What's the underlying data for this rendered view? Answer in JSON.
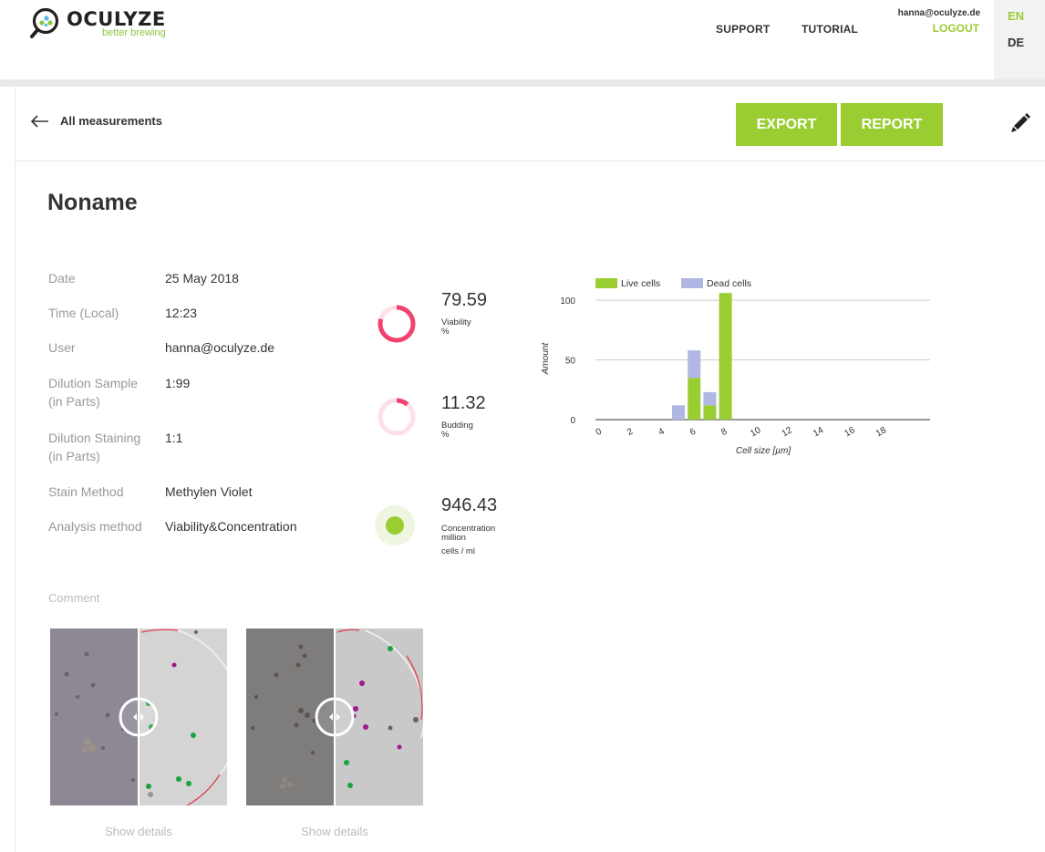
{
  "header": {
    "logo_name": "OCULYZE",
    "logo_tagline": "better brewing",
    "nav": {
      "support": "SUPPORT",
      "tutorial": "TUTORIAL"
    },
    "user_email": "hanna@oculyze.de",
    "logout": "LOGOUT",
    "languages": {
      "en": "EN",
      "de": "DE",
      "active": "EN"
    }
  },
  "toolbar": {
    "back_label": "All measurements",
    "export_label": "EXPORT",
    "report_label": "REPORT",
    "accent_color": "#9acd32"
  },
  "measurement": {
    "title": "Noname",
    "details": [
      {
        "label": "Date",
        "value": "25 May 2018"
      },
      {
        "label": "Time (Local)",
        "value": "12:23"
      },
      {
        "label": "User",
        "value": "hanna@oculyze.de"
      },
      {
        "label": "Dilution Sample (in Parts)",
        "value": "1:99"
      },
      {
        "label": "Dilution Staining (in Parts)",
        "value": "1:1"
      },
      {
        "label": "Stain Method",
        "value": "Methylen Violet"
      },
      {
        "label": "Analysis method",
        "value": "Viability&Concentration"
      }
    ],
    "metrics": {
      "viability": {
        "value": "79.59",
        "label": "Viability",
        "unit": "%",
        "fraction": 0.7959,
        "color": "#f0426f"
      },
      "budding": {
        "value": "11.32",
        "label": "Budding",
        "unit": "%",
        "fraction": 0.1132,
        "color": "#f0426f"
      },
      "concentration": {
        "value": "946.43",
        "label": "Concentration",
        "unit_line1": "million",
        "unit_line2": "cells / ml",
        "color": "#9acd32"
      }
    },
    "comment_label": "Comment",
    "images": [
      {
        "show_details": "Show details"
      },
      {
        "show_details": "Show details"
      }
    ]
  },
  "chart_data": {
    "type": "bar",
    "stacked": true,
    "xlabel": "Cell size [µm]",
    "ylabel": "Amount",
    "x": [
      0,
      1,
      2,
      3,
      4,
      5,
      6,
      7,
      8,
      9,
      10,
      11,
      12,
      13,
      14,
      15,
      16,
      17,
      18,
      19
    ],
    "x_tick_labels": [
      "0",
      "2",
      "4",
      "6",
      "8",
      "10",
      "12",
      "14",
      "16",
      "18"
    ],
    "x_ticks": [
      0,
      2,
      4,
      6,
      8,
      10,
      12,
      14,
      16,
      18
    ],
    "y_ticks": [
      0,
      50,
      100
    ],
    "ylim": [
      0,
      110
    ],
    "series": [
      {
        "name": "Live cells",
        "color": "#9acd32",
        "values": [
          0,
          0,
          0,
          0,
          0,
          0,
          35,
          12,
          106,
          0,
          0,
          0,
          0,
          0,
          0,
          0,
          0,
          0,
          0,
          0
        ]
      },
      {
        "name": "Dead cells",
        "color": "#b0b7e3",
        "values": [
          0,
          0,
          0,
          0,
          0,
          12,
          23,
          11,
          0,
          0,
          0,
          0,
          0,
          0,
          0,
          0,
          0,
          0,
          0,
          0
        ]
      }
    ],
    "legend": "top-left",
    "grid": true
  }
}
